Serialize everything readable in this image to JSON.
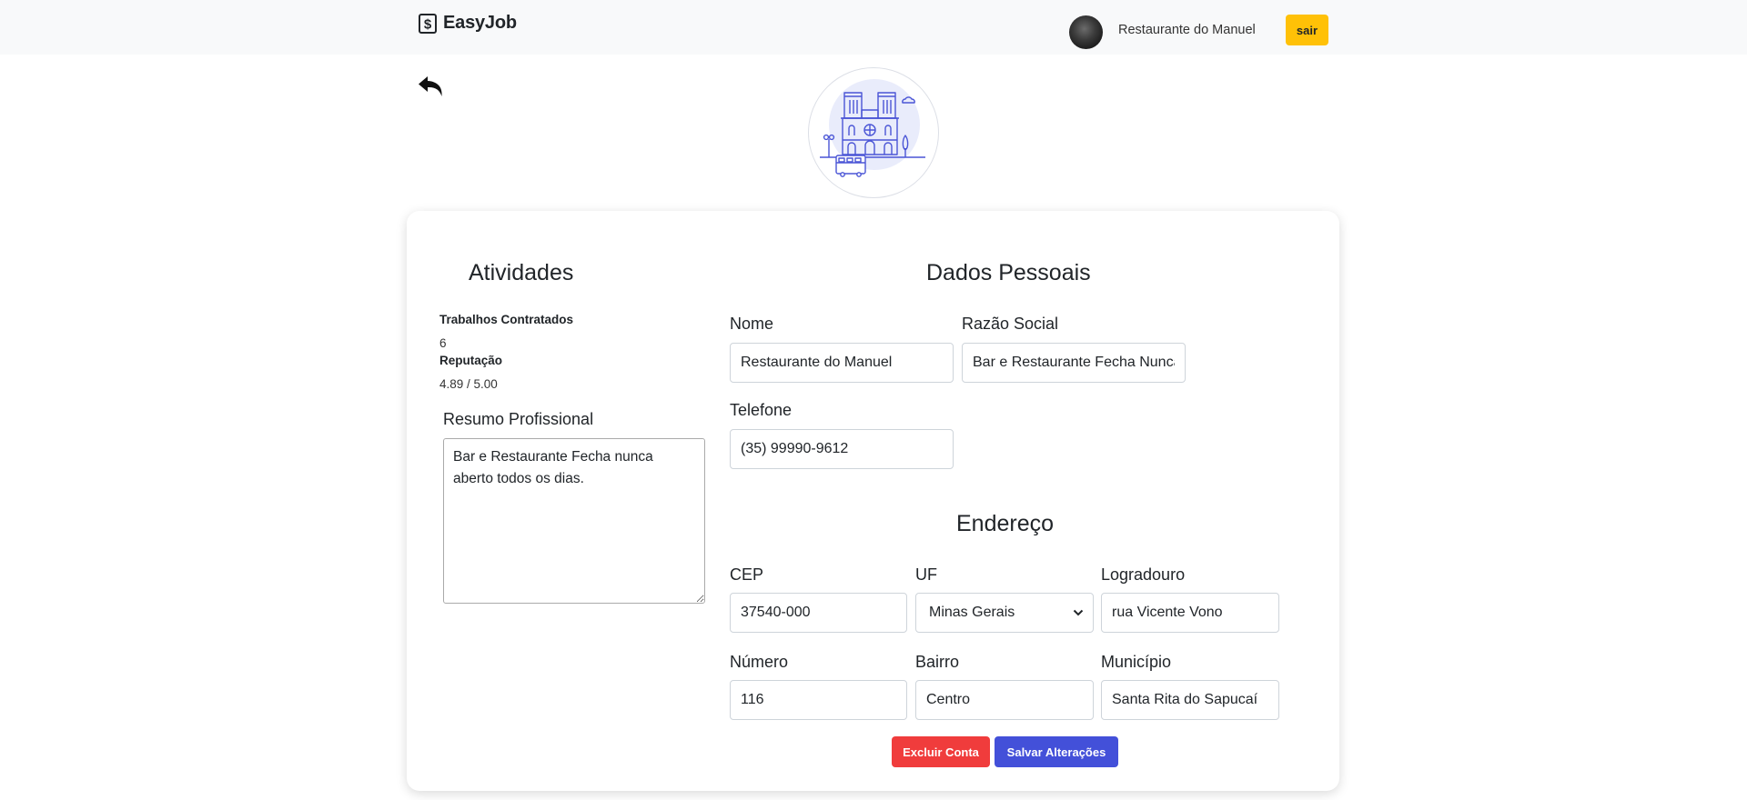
{
  "navbar": {
    "brand": "EasyJob",
    "user_name": "Restaurante do Manuel",
    "logout_label": "sair"
  },
  "activities": {
    "title": "Atividades",
    "jobs_label": "Trabalhos Contratados",
    "jobs_value": "6",
    "reputation_label": "Reputação",
    "reputation_value": "4.89 / 5.00",
    "summary_label": "Resumo Profissional",
    "summary_text": "Bar e Restaurante Fecha nunca aberto todos os dias."
  },
  "personal": {
    "title": "Dados Pessoais",
    "name_label": "Nome",
    "name_value": "Restaurante do Manuel",
    "company_label": "Razão Social",
    "company_value": "Bar e Restaurante Fecha Nunca",
    "phone_label": "Telefone",
    "phone_value": "(35) 99990-9612"
  },
  "address": {
    "title": "Endereço",
    "cep_label": "CEP",
    "cep_value": "37540-000",
    "uf_label": "UF",
    "uf_value": "Minas Gerais",
    "street_label": "Logradouro",
    "street_value": "rua Vicente Vono",
    "number_label": "Número",
    "number_value": "116",
    "district_label": "Bairro",
    "district_value": "Centro",
    "city_label": "Município",
    "city_value": "Santa Rita do Sapucaí"
  },
  "actions": {
    "delete_label": "Excluir Conta",
    "save_label": "Salvar Alterações"
  },
  "colors": {
    "navbar_bg": "#f8f9fa",
    "warning": "#ffc107",
    "danger": "#f03c3c",
    "primary": "#4350d9",
    "illustration": "#4a55d6"
  },
  "icons": {
    "brand": "dollar-sign-icon",
    "back": "undo-arrow-icon",
    "profile": "cathedral-illustration",
    "select": "chevron-down-icon"
  }
}
